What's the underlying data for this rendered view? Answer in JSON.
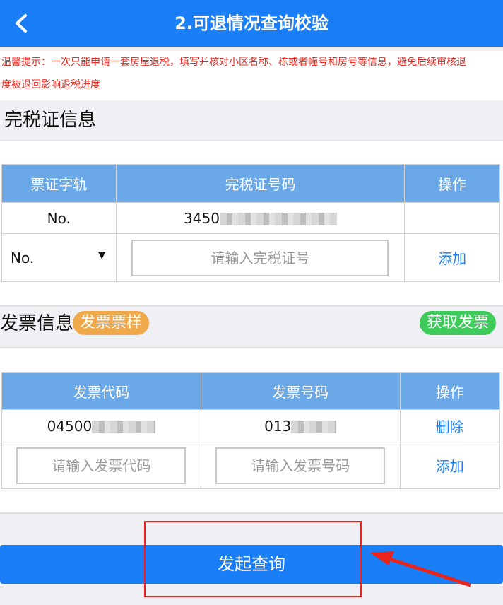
{
  "header": {
    "title": "2.可退情况查询校验"
  },
  "notice": {
    "line1": "温馨提示：一次只能申请一套房屋退税，填写并核对小区名称、栋或者幢号和房号等信息，避免后续审核退",
    "line2": "度被退回影响退税进度"
  },
  "tax_cert": {
    "section_title": "完税证信息",
    "columns": [
      "票证字轨",
      "完税证号码",
      "操作"
    ],
    "row": {
      "track": "No.",
      "number_prefix": "3450"
    },
    "new_row": {
      "track_select": "No.",
      "placeholder": "请输入完税证号",
      "action": "添加"
    }
  },
  "invoice": {
    "section_title": "发票信息",
    "sample_label": "发票票样",
    "fetch_label": "获取发票",
    "columns": [
      "发票代码",
      "发票号码",
      "操作"
    ],
    "row": {
      "code_prefix": "04500",
      "number_prefix": "013",
      "action": "删除"
    },
    "new_row": {
      "code_placeholder": "请输入发票代码",
      "number_placeholder": "请输入发票号码",
      "action": "添加"
    }
  },
  "submit": {
    "label": "发起查询"
  },
  "colors": {
    "primary": "#1a7ef6",
    "table_header": "#6aa8e8",
    "warning": "#e8241c",
    "sample_pill": "#f0a94a",
    "fetch_pill": "#3ecb5c"
  }
}
